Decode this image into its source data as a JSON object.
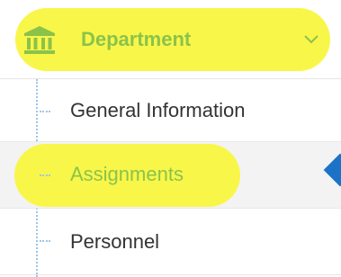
{
  "nav": {
    "section": {
      "label": "Department",
      "icon": "institution-icon",
      "expand_icon": "chevron-down-icon",
      "highlight_color": "#f9f64a",
      "accent_color": "#8bc34a"
    },
    "items": [
      {
        "label": "General Information",
        "active": false
      },
      {
        "label": "Assignments",
        "active": true
      },
      {
        "label": "Personnel",
        "active": false
      }
    ],
    "active_marker_color": "#1a73c7"
  }
}
